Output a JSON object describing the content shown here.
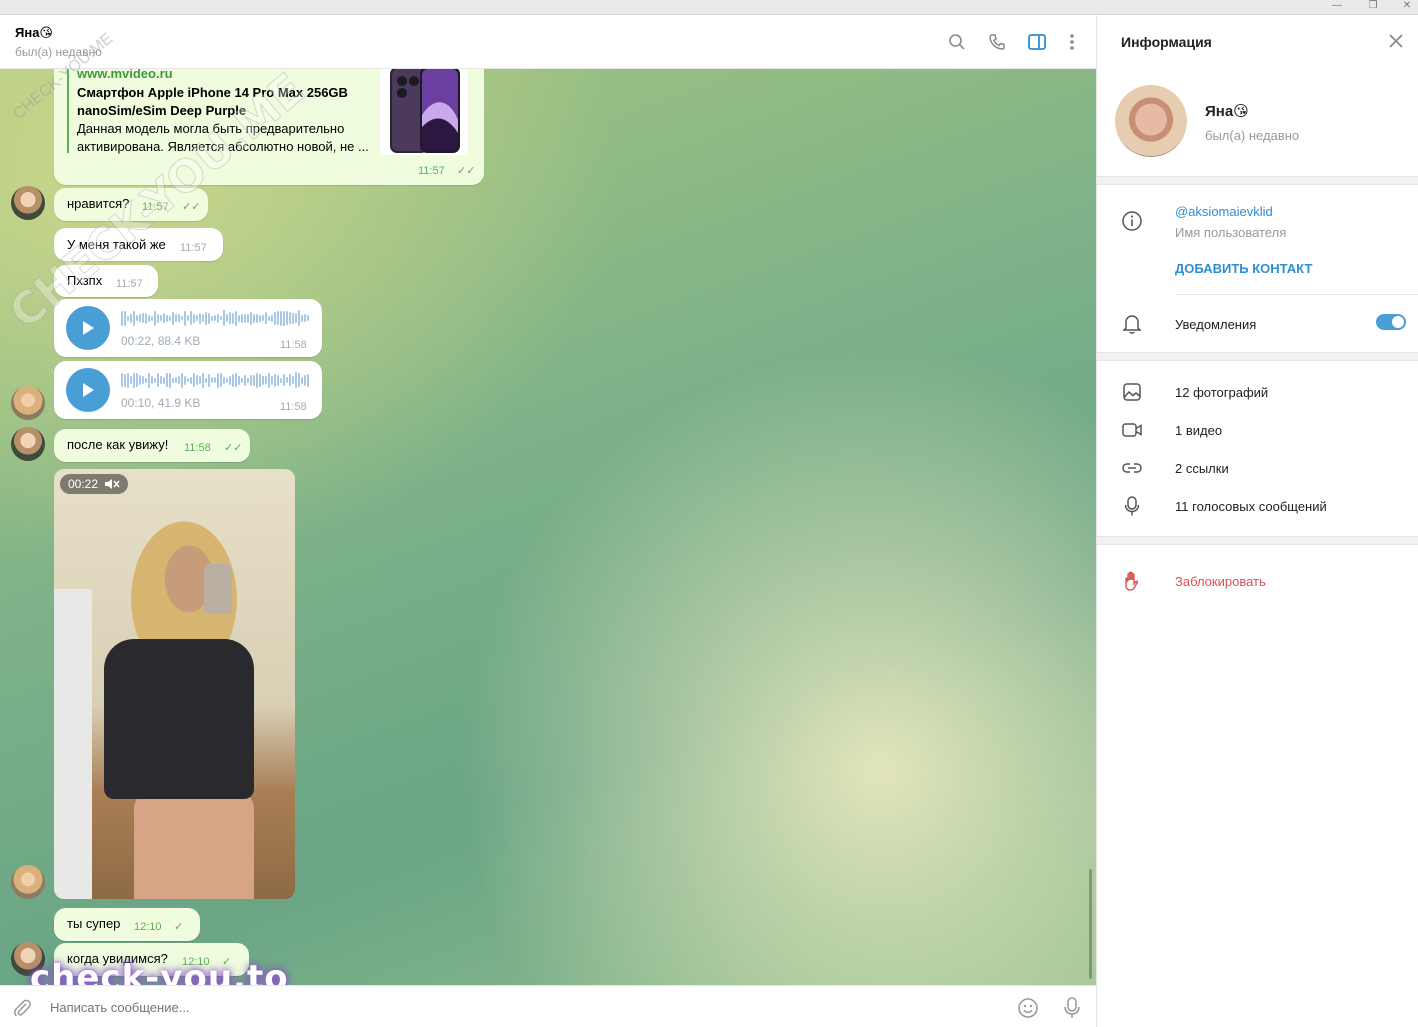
{
  "window": {
    "minimize": "—",
    "maximize": "❐",
    "close": "✕"
  },
  "header": {
    "title": "Яна😘",
    "status": "был(а) недавно"
  },
  "messages": {
    "link": {
      "site": "www.mvideo.ru",
      "title": "Смартфон Apple iPhone 14 Pro Max 256GB nanoSim/eSim Deep Purple",
      "desc": "Данная модель могла быть предварительно активирована. Является абсолютно новой, не ...",
      "time": "11:57"
    },
    "m1": {
      "text": "нравится?",
      "time": "11:57"
    },
    "m2": {
      "text": "У меня такой же",
      "time": "11:57"
    },
    "m3": {
      "text": "Пхзпх",
      "time": "11:57"
    },
    "voice1": {
      "meta": "00:22, 88.4 KB",
      "time": "11:58"
    },
    "voice2": {
      "meta": "00:10, 41.9 KB",
      "time": "11:58"
    },
    "m4": {
      "text": "после как увижу!",
      "time": "11:58"
    },
    "video": {
      "duration": "00:22"
    },
    "m5": {
      "text": "ты супер",
      "time": "12:10"
    },
    "m6": {
      "text": "когда увидимся?",
      "time": "12:10"
    }
  },
  "composer": {
    "placeholder": "Написать сообщение..."
  },
  "watermark": {
    "bottom": "check-you.to",
    "diagonal": "CHECK-YOU.ME",
    "diagonal_small": "CHECK-YOU.ME"
  },
  "info": {
    "title": "Информация",
    "name": "Яна😘",
    "status": "был(а) недавно",
    "username": "@aksiomaievklid",
    "username_label": "Имя пользователя",
    "add_contact": "ДОБАВИТЬ КОНТАКТ",
    "notifications": "Уведомления",
    "notifications_on": true,
    "photos": "12 фотографий",
    "videos": "1 видео",
    "links": "2 ссылки",
    "voice": "11 голосовых сообщений",
    "block": "Заблокировать"
  },
  "colors": {
    "accent": "#4a9ed6",
    "outgoing_bubble": "#effdde",
    "check_green": "#5faf58",
    "danger": "#d9534f"
  },
  "icons": [
    "search-icon",
    "phone-icon",
    "sidebar-toggle-icon",
    "more-vertical-icon",
    "attach-icon",
    "emoji-icon",
    "mic-icon",
    "info-icon",
    "bell-icon",
    "photo-icon",
    "video-icon",
    "link-icon",
    "close-icon",
    "block-hand-icon",
    "play-icon",
    "mute-icon"
  ]
}
